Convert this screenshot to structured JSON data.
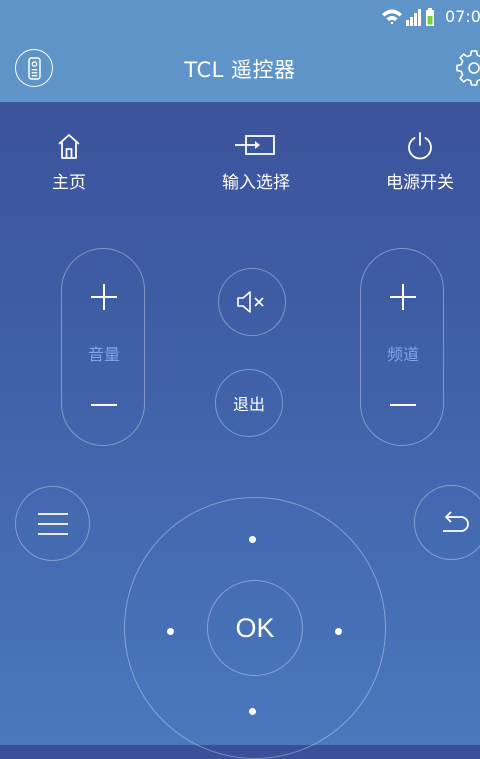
{
  "status_bar": {
    "time": "07:0"
  },
  "header": {
    "title": "TCL 遥控器"
  },
  "top_actions": {
    "home": {
      "label": "主页",
      "icon": "home-icon"
    },
    "input": {
      "label": "输入选择",
      "icon": "input-source-icon"
    },
    "power": {
      "label": "电源开关",
      "icon": "power-icon"
    }
  },
  "volume": {
    "label": "音量"
  },
  "channel": {
    "label": "频道"
  },
  "mute": {
    "icon": "mute-icon"
  },
  "exit": {
    "label": "退出"
  },
  "menu": {
    "icon": "menu-icon"
  },
  "back": {
    "icon": "back-icon"
  },
  "dpad": {
    "ok_label": "OK"
  },
  "colors": {
    "header_bg": "#5f94c9",
    "bg_top": "#3a4f98",
    "bg_bottom": "#4a78bd",
    "pill_label": "#7fa6e2"
  }
}
